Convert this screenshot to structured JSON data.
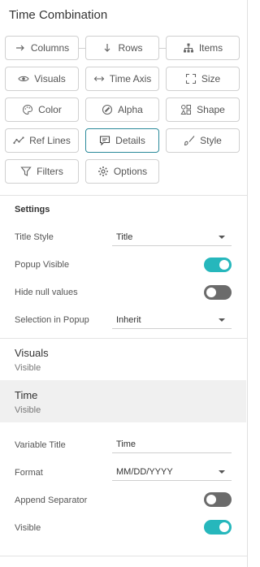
{
  "panel": {
    "title": "Time Combination"
  },
  "chips": {
    "columns": {
      "label": "Columns",
      "icon": "arrow-right-icon"
    },
    "rows": {
      "label": "Rows",
      "icon": "arrow-down-icon"
    },
    "items": {
      "label": "Items",
      "icon": "hierarchy-icon"
    },
    "visuals": {
      "label": "Visuals",
      "icon": "eye-icon"
    },
    "time_axis": {
      "label": "Time Axis",
      "icon": "double-arrow-icon"
    },
    "size": {
      "label": "Size",
      "icon": "resize-corners-icon"
    },
    "color": {
      "label": "Color",
      "icon": "palette-icon"
    },
    "alpha": {
      "label": "Alpha",
      "icon": "alpha-circle-icon"
    },
    "shape": {
      "label": "Shape",
      "icon": "shapes-icon"
    },
    "ref_lines": {
      "label": "Ref Lines",
      "icon": "line-chart-icon"
    },
    "details": {
      "label": "Details",
      "icon": "comment-icon",
      "active": true
    },
    "style": {
      "label": "Style",
      "icon": "brush-icon"
    },
    "filters": {
      "label": "Filters",
      "icon": "filter-icon"
    },
    "options": {
      "label": "Options",
      "icon": "gear-icon"
    }
  },
  "settings": {
    "heading": "Settings",
    "title_style": {
      "label": "Title Style",
      "value": "Title"
    },
    "popup_visible": {
      "label": "Popup Visible",
      "on": true
    },
    "hide_null": {
      "label": "Hide null values",
      "on": false
    },
    "selection_popup": {
      "label": "Selection in Popup",
      "value": "Inherit"
    }
  },
  "groups": {
    "visuals": {
      "title": "Visuals",
      "sub": "Visible"
    },
    "time": {
      "title": "Time",
      "sub": "Visible"
    }
  },
  "time": {
    "variable_title": {
      "label": "Variable Title",
      "value": "Time"
    },
    "format": {
      "label": "Format",
      "value": "MM/DD/YYYY"
    },
    "append_separator": {
      "label": "Append Separator",
      "on": false
    },
    "visible": {
      "label": "Visible",
      "on": true
    }
  },
  "colors": {
    "accent": "#26b7bc",
    "active_border": "#2a8a9a",
    "toggle_off": "#6b6b6b"
  }
}
